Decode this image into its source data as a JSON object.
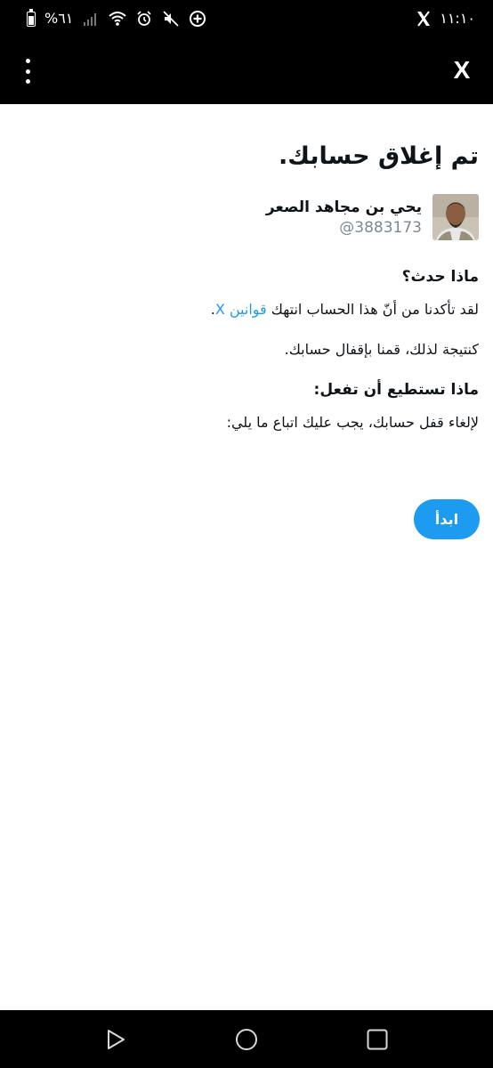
{
  "status_bar": {
    "time": "١١:١٠",
    "battery_text": "%٦١",
    "icons": [
      "battery-icon",
      "signal-icon",
      "wifi-icon",
      "alarm-icon",
      "mute-icon",
      "data-saver-icon",
      "x-app-icon"
    ]
  },
  "app_bar": {
    "close_label": "X",
    "menu_icon": "more-vertical-icon"
  },
  "page": {
    "title": "تم إغلاق حسابك.",
    "user": {
      "display_name": "يحي بن مجاهد الصعر",
      "handle": "@3883173"
    },
    "what_happened": {
      "heading": "ماذا حدث؟",
      "text_before_link": "لقد تأكدنا من أنّ هذا الحساب انتهك ",
      "link_text": "قوانين X",
      "text_after_link": ".",
      "result_text": "كنتيجة لذلك، قمنا بإقفال حسابك."
    },
    "what_you_can_do": {
      "heading": "ماذا تستطيع أن تفعل:",
      "text": "لإلغاء قفل حسابك، يجب عليك اتباع ما يلي:"
    },
    "start_button": "ابدأ"
  },
  "colors": {
    "accent": "#1d9bf0",
    "handle": "#7b8a97",
    "bars": "#000000"
  },
  "nav_bar": {
    "icons": [
      "back-icon",
      "home-icon",
      "recents-icon"
    ]
  }
}
